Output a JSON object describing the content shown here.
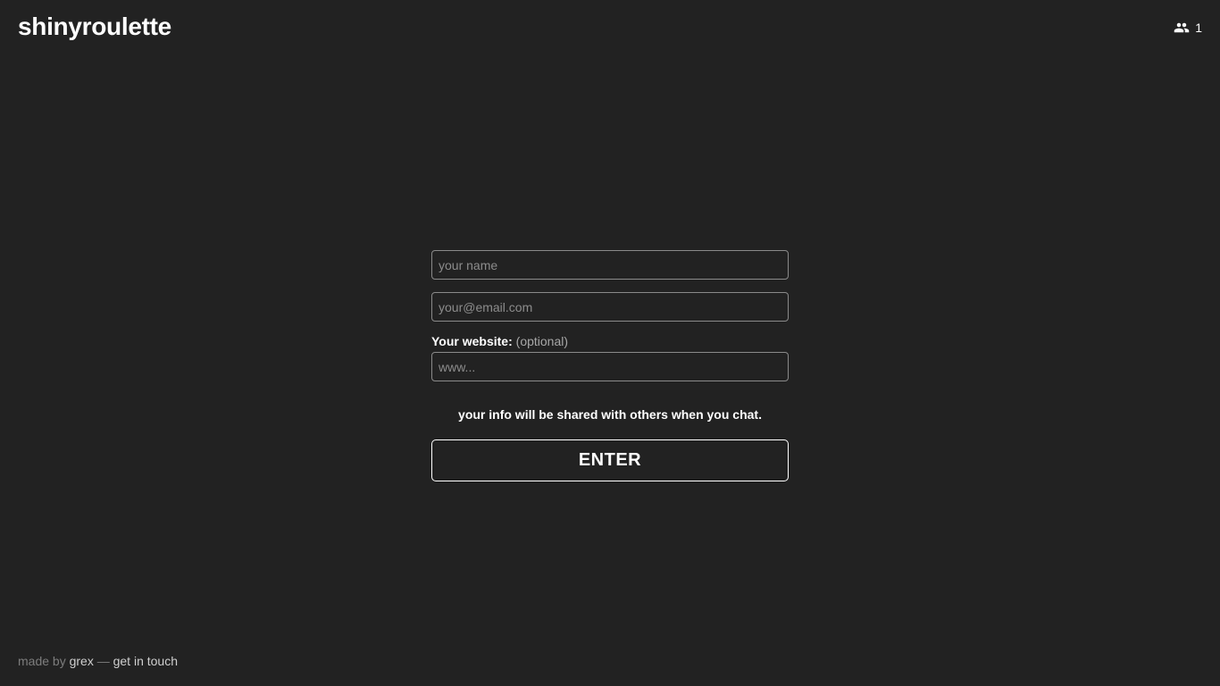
{
  "header": {
    "brand": "shinyroulette",
    "online_count": "1",
    "online_icon": "people-icon"
  },
  "form": {
    "name_placeholder": "your name",
    "email_placeholder": "your@email.com",
    "website_label": "Your website:",
    "website_optional": "(optional)",
    "website_placeholder": "www...",
    "notice": "your info will be shared with others when you chat.",
    "enter_label": "ENTER"
  },
  "footer": {
    "made_by": "made by",
    "author": "grex",
    "separator": "—",
    "contact": "get in touch"
  },
  "colors": {
    "background": "#222222",
    "text": "#ffffff",
    "muted": "#7d7d7d"
  }
}
